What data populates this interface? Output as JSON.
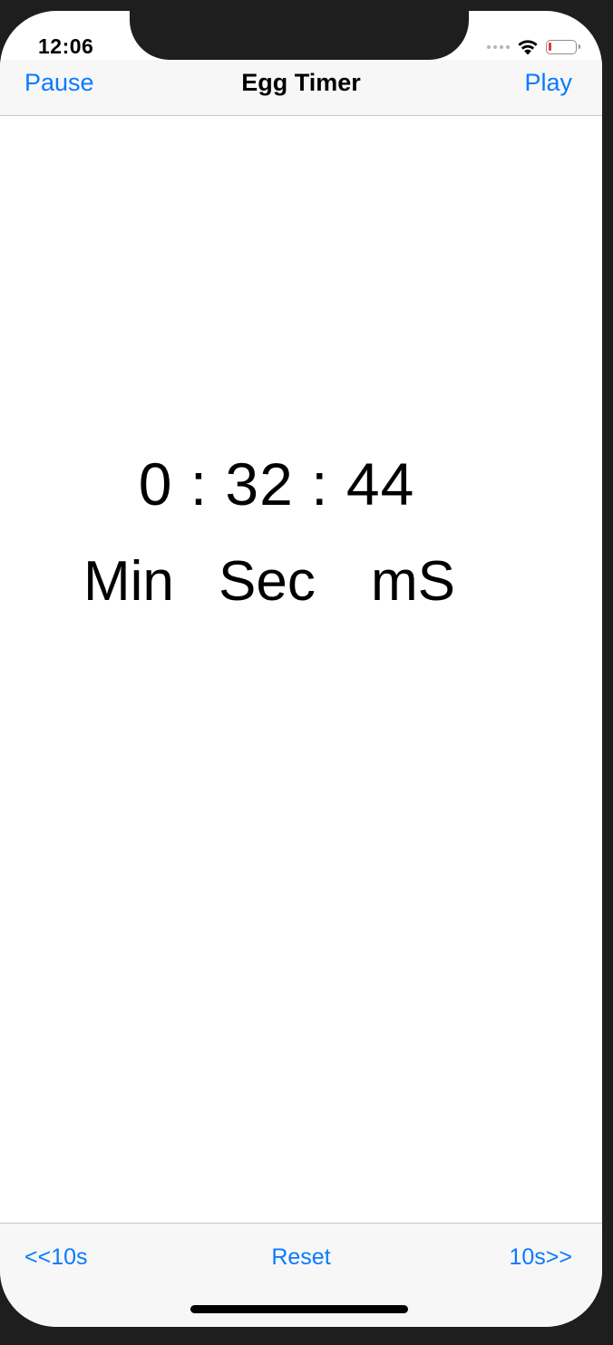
{
  "status_bar": {
    "time": "12:06",
    "battery_color": "#e53935"
  },
  "nav_bar": {
    "left_button": "Pause",
    "title": "Egg Timer",
    "right_button": "Play",
    "accent_color": "#0a7aff"
  },
  "timer": {
    "display": "0 : 32 : 44",
    "units": {
      "minutes": "Min",
      "seconds": "Sec",
      "milliseconds": "mS"
    }
  },
  "toolbar": {
    "back_button": "<<10s",
    "reset_button": "Reset",
    "forward_button": "10s>>"
  },
  "icons": [
    "signal-dots-icon",
    "wifi-icon",
    "battery-icon"
  ]
}
